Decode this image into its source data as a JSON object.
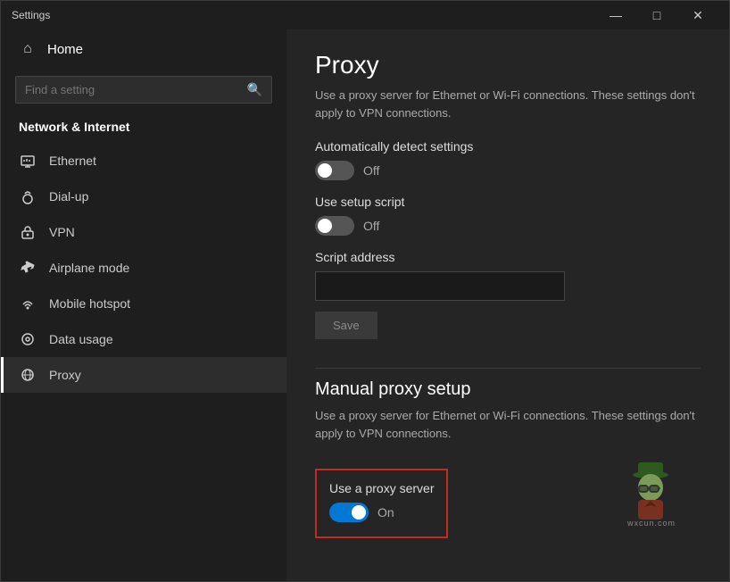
{
  "window": {
    "title": "Settings",
    "controls": {
      "minimize": "—",
      "maximize": "□",
      "close": "✕"
    }
  },
  "sidebar": {
    "home_label": "Home",
    "search_placeholder": "Find a setting",
    "section_label": "Network & Internet",
    "items": [
      {
        "id": "ethernet",
        "label": "Ethernet",
        "icon": "🖧"
      },
      {
        "id": "dialup",
        "label": "Dial-up",
        "icon": "📞"
      },
      {
        "id": "vpn",
        "label": "VPN",
        "icon": "🔒"
      },
      {
        "id": "airplane",
        "label": "Airplane mode",
        "icon": "✈"
      },
      {
        "id": "hotspot",
        "label": "Mobile hotspot",
        "icon": "📶"
      },
      {
        "id": "datausage",
        "label": "Data usage",
        "icon": "⊙"
      },
      {
        "id": "proxy",
        "label": "Proxy",
        "icon": "🌐",
        "active": true
      }
    ]
  },
  "main": {
    "page_title": "Proxy",
    "auto_section": {
      "desc": "Use a proxy server for Ethernet or Wi-Fi connections. These settings don't apply to VPN connections.",
      "auto_detect_label": "Automatically detect settings",
      "auto_detect_state": "Off",
      "setup_script_label": "Use setup script",
      "setup_script_state": "Off",
      "script_address_label": "Script address",
      "script_address_placeholder": "",
      "save_label": "Save"
    },
    "manual_section": {
      "title": "Manual proxy setup",
      "desc": "Use a proxy server for Ethernet or Wi-Fi connections. These settings don't apply to VPN connections.",
      "use_proxy_label": "Use a proxy server",
      "use_proxy_state": "On"
    }
  },
  "watermark": {
    "text": "wxcun.com"
  }
}
